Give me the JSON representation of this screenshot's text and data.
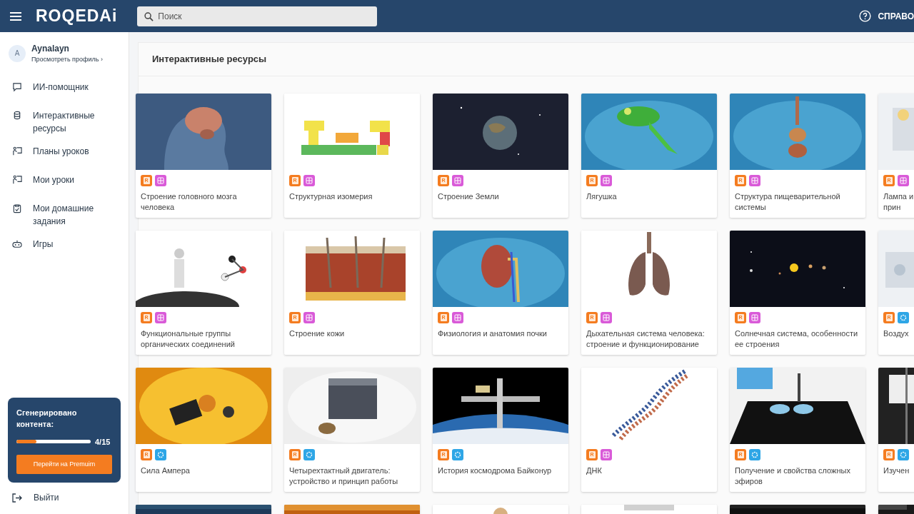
{
  "header": {
    "logo": "ROQEDAi",
    "search": {
      "placeholder": "Поиск"
    },
    "help": "СПРАВО"
  },
  "sidebar": {
    "profile": {
      "avatar": "A",
      "name": "Aynalayn",
      "link": "Просмотреть профиль",
      "chevron": "›"
    },
    "items": [
      {
        "label": "ИИ-помощник",
        "selected": false
      },
      {
        "label": "Интерактивные ресурсы",
        "selected": false
      },
      {
        "label": "Планы уроков",
        "selected": false
      },
      {
        "label": "Мои уроки",
        "selected": false
      },
      {
        "label": "Мои домашние задания",
        "selected": false
      },
      {
        "label": "Игры",
        "selected": false
      }
    ],
    "usage": {
      "title": "Сгенерировано контента:",
      "level": 0.27,
      "reading": "4/15",
      "button": "Перейти на Premuim"
    },
    "logout": "Выйти"
  },
  "main": {
    "title": "Интерактивные ресурсы",
    "cards": [
      {
        "kind": "resource",
        "badges": [
          {
            "kind": "letter",
            "text": "R"
          },
          {
            "kind": "grid"
          }
        ],
        "title": "Строение головного мозга человека"
      },
      {
        "kind": "resource",
        "badges": [
          {
            "kind": "letter",
            "text": "R"
          },
          {
            "kind": "grid"
          }
        ],
        "title": "Структурная изомерия"
      },
      {
        "kind": "resource",
        "badges": [
          {
            "kind": "letter",
            "text": "R"
          },
          {
            "kind": "grid"
          }
        ],
        "title": "Строение Земли"
      },
      {
        "kind": "resource",
        "badges": [
          {
            "kind": "letter",
            "text": "R"
          },
          {
            "kind": "grid"
          }
        ],
        "title": "Лягушка"
      },
      {
        "kind": "resource",
        "badges": [
          {
            "kind": "letter",
            "text": "R"
          },
          {
            "kind": "grid"
          }
        ],
        "title": "Структура пищеварительной системы"
      },
      {
        "kind": "resource",
        "badges": [
          {
            "kind": "letter",
            "text": "R"
          },
          {
            "kind": "grid"
          }
        ],
        "title": "Лампа и прин"
      },
      {
        "kind": "resource",
        "badges": [
          {
            "kind": "letter",
            "text": "R"
          },
          {
            "kind": "grid"
          }
        ],
        "title": "Функциональные группы органических соединений"
      },
      {
        "kind": "resource",
        "badges": [
          {
            "kind": "letter",
            "text": "R"
          },
          {
            "kind": "grid"
          }
        ],
        "title": "Строение кожи"
      },
      {
        "kind": "resource",
        "badges": [
          {
            "kind": "letter",
            "text": "R"
          },
          {
            "kind": "grid"
          }
        ],
        "title": "Физиология и анатомия почки"
      },
      {
        "kind": "resource",
        "badges": [
          {
            "kind": "letter",
            "text": "R"
          },
          {
            "kind": "grid"
          }
        ],
        "title": "Дыхательная система человека: строение и функционирование"
      },
      {
        "kind": "resource",
        "badges": [
          {
            "kind": "letter",
            "text": "R"
          },
          {
            "kind": "grid"
          }
        ],
        "title": "Солнечная система, особенности ее строения"
      },
      {
        "kind": "resource",
        "badges": [
          {
            "kind": "letter",
            "text": "R"
          },
          {
            "kind": "flower"
          }
        ],
        "title": "Воздух"
      },
      {
        "kind": "resource",
        "badges": [
          {
            "kind": "letter",
            "text": "R"
          },
          {
            "kind": "flower"
          }
        ],
        "title": "Сила Ампера"
      },
      {
        "kind": "resource",
        "badges": [
          {
            "kind": "letter",
            "text": "R"
          },
          {
            "kind": "flower"
          }
        ],
        "title": "Четырехтактный двигатель: устройство и принцип работы"
      },
      {
        "kind": "resource",
        "badges": [
          {
            "kind": "letter",
            "text": "R"
          },
          {
            "kind": "flower"
          }
        ],
        "title": "История космодрома Байконур"
      },
      {
        "kind": "resource",
        "badges": [
          {
            "kind": "letter",
            "text": "R"
          },
          {
            "kind": "grid"
          }
        ],
        "title": "ДНК"
      },
      {
        "kind": "resource",
        "badges": [
          {
            "kind": "letter",
            "text": "R"
          },
          {
            "kind": "flower"
          }
        ],
        "title": "Получение и свойства сложных эфиров"
      },
      {
        "kind": "resource",
        "badges": [
          {
            "kind": "letter",
            "text": "R"
          },
          {
            "kind": "flower"
          }
        ],
        "title": "Изучен"
      },
      {
        "kind": "picture"
      },
      {
        "kind": "picture"
      },
      {
        "kind": "picture"
      },
      {
        "kind": "picture"
      },
      {
        "kind": "picture"
      },
      {
        "kind": "picture"
      }
    ]
  }
}
